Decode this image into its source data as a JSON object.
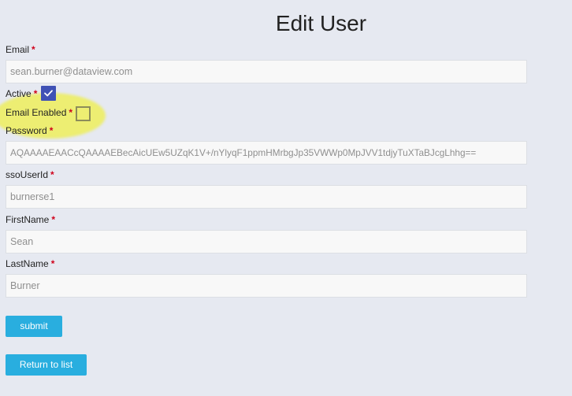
{
  "page": {
    "title": "Edit User"
  },
  "form": {
    "required_marker": "*",
    "email": {
      "label": "Email",
      "value": "sean.burner@dataview.com"
    },
    "active": {
      "label": "Active",
      "checked": true
    },
    "email_enabled": {
      "label": "Email Enabled",
      "checked": false
    },
    "password": {
      "label": "Password",
      "value": "AQAAAAEAACcQAAAAEBecAicUEw5UZqK1V+/nYlyqF1ppmHMrbgJp35VWWp0MpJVV1tdjyTuXTaBJcgLhhg=="
    },
    "sso_user_id": {
      "label": "ssoUserId",
      "value": "burnerse1"
    },
    "first_name": {
      "label": "FirstName",
      "value": "Sean"
    },
    "last_name": {
      "label": "LastName",
      "value": "Burner"
    }
  },
  "actions": {
    "submit_label": "submit",
    "return_label": "Return to list"
  },
  "colors": {
    "background": "#e6e9f1",
    "button": "#29aedf",
    "checkbox_checked": "#3f51b5",
    "required": "#d0021b",
    "highlight": "#f0f03c"
  }
}
